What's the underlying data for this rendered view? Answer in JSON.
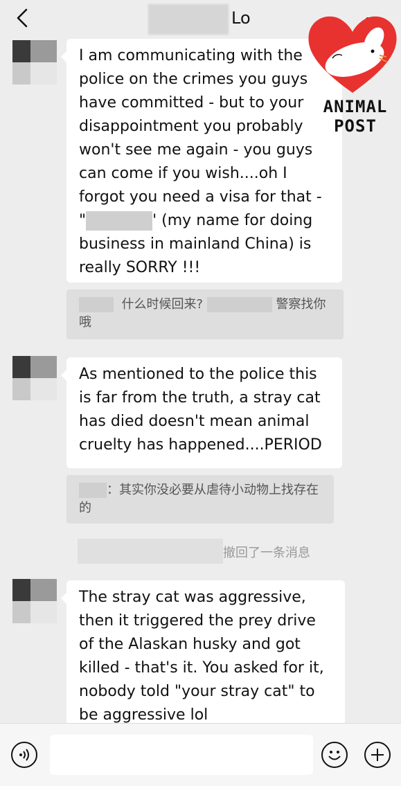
{
  "header": {
    "title_suffix": "Lo",
    "back_icon": "chevron-left-icon",
    "more_icon": "more-dots-icon"
  },
  "watermark": {
    "line1": "ANIMAL",
    "line2": "POST",
    "heart_color": "#e8322f"
  },
  "messages": [
    {
      "text": "I am communicating with the police on the crimes you guys have committed - but to your disappointment you probably won't see me again - you guys can come if you wish....oh I forgot you need a visa for that - \"",
      "text_after_blur": "' (my name for doing business in mainland China) is really SORRY !!!",
      "quote_part1": "什么时候回来?",
      "quote_part2": "警察找你哦"
    },
    {
      "text": "As mentioned to the police this is far from the truth, a stray cat has died doesn't mean animal cruelty has happened....PERIOD",
      "quote": "：其实你没必要从虐待小动物上找存在的"
    },
    {
      "text": "The stray cat was aggressive, then it triggered the prey drive of the Alaskan husky and got killed - that's it. You asked for it, nobody told \"your stray cat\" to be aggressive lol"
    }
  ],
  "recalled_notice": "撤回了一条消息",
  "input_bar": {
    "voice_icon": "voice-icon",
    "emoji_icon": "emoji-icon",
    "add_icon": "plus-icon"
  }
}
